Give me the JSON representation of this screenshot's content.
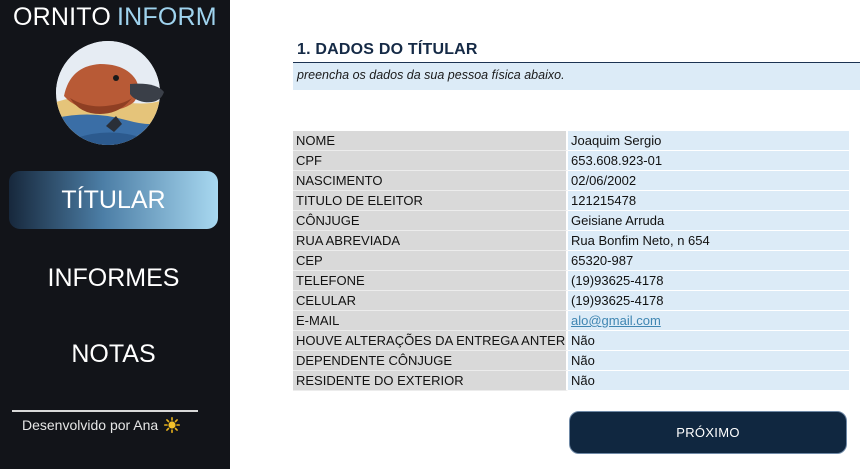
{
  "brand": {
    "part1": "ORNITO",
    "part2": "INFORM"
  },
  "sidebar": {
    "items": [
      {
        "label": "TÍTULAR",
        "active": true
      },
      {
        "label": "INFORMES",
        "active": false
      },
      {
        "label": "NOTAS",
        "active": false
      }
    ],
    "credit": "Desenvolvido por Ana",
    "credit_icon": "sun-icon",
    "logo_icon": "platypus-logo"
  },
  "main": {
    "section_title": "1. DADOS DO TÍTULAR",
    "subtitle": "preencha os dados da sua pessoa física abaixo.",
    "fields": [
      {
        "label": "NOME",
        "value": "Joaquim Sergio"
      },
      {
        "label": "CPF",
        "value": "653.608.923-01"
      },
      {
        "label": "NASCIMENTO",
        "value": "02/06/2002"
      },
      {
        "label": "TITULO DE ELEITOR",
        "value": "121215478"
      },
      {
        "label": "CÔNJUGE",
        "value": "Geisiane Arruda"
      },
      {
        "label": "RUA ABREVIADA",
        "value": "Rua Bonfim Neto, n 654"
      },
      {
        "label": "CEP",
        "value": "65320-987"
      },
      {
        "label": "TELEFONE",
        "value": "(19)93625-4178"
      },
      {
        "label": "CELULAR",
        "value": "(19)93625-4178"
      },
      {
        "label": "E-MAIL",
        "value": "alo@gmail.com"
      },
      {
        "label": "HOUVE ALTERAÇÕES DA ENTREGA ANTERIOR",
        "value": "Não"
      },
      {
        "label": "DEPENDENTE CÔNJUGE",
        "value": "Não"
      },
      {
        "label": "RESIDENTE DO EXTERIOR",
        "value": "Não"
      }
    ],
    "next_button": "PRÓXIMO"
  },
  "colors": {
    "sidebar_bg": "#121419",
    "accent_light": "#9fd3ee",
    "label_bg": "#d9d9d9",
    "value_bg": "#dcebf7",
    "button_bg": "#102740",
    "title_color": "#152a46",
    "link_color": "#3f86b2"
  }
}
